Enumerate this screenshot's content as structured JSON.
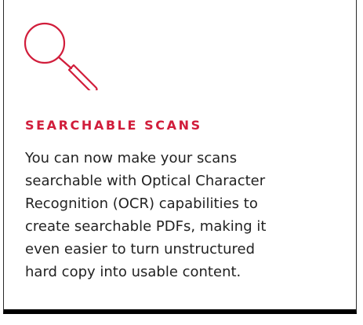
{
  "card": {
    "icon": "magnifying-glass-icon",
    "title": "SEARCHABLE SCANS",
    "description_lines": [
      "You can now make your scans",
      "searchable with Optical Character",
      "Recognition (OCR) capabilities to",
      "create searchable PDFs, making it",
      "even easier to turn unstructured",
      "hard copy into usable content."
    ]
  },
  "colors": {
    "accent": "#d11d3b",
    "text": "#222222",
    "border": "#000000"
  }
}
